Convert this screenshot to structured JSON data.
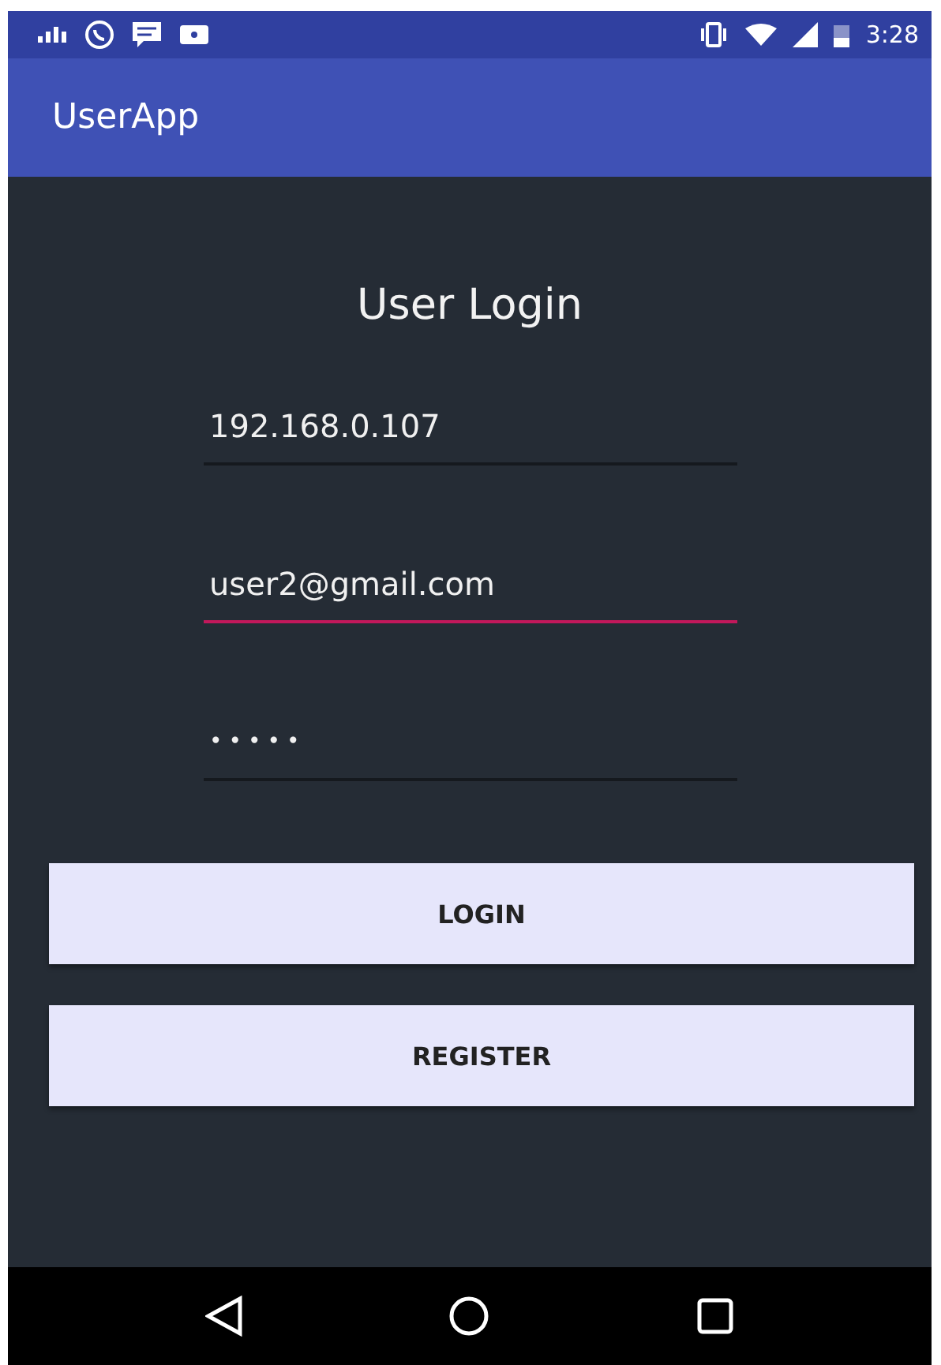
{
  "status_bar": {
    "time": "3:28"
  },
  "app_bar": {
    "title": "UserApp"
  },
  "form": {
    "title": "User Login",
    "fields": [
      {
        "kind": "text",
        "value": "192.168.0.107",
        "focused": false
      },
      {
        "kind": "email",
        "value": "user2@gmail.com",
        "focused": true
      },
      {
        "kind": "password",
        "value": "•••••",
        "focused": false
      }
    ]
  },
  "buttons": [
    {
      "label": "LOGIN"
    },
    {
      "label": "REGISTER"
    }
  ]
}
